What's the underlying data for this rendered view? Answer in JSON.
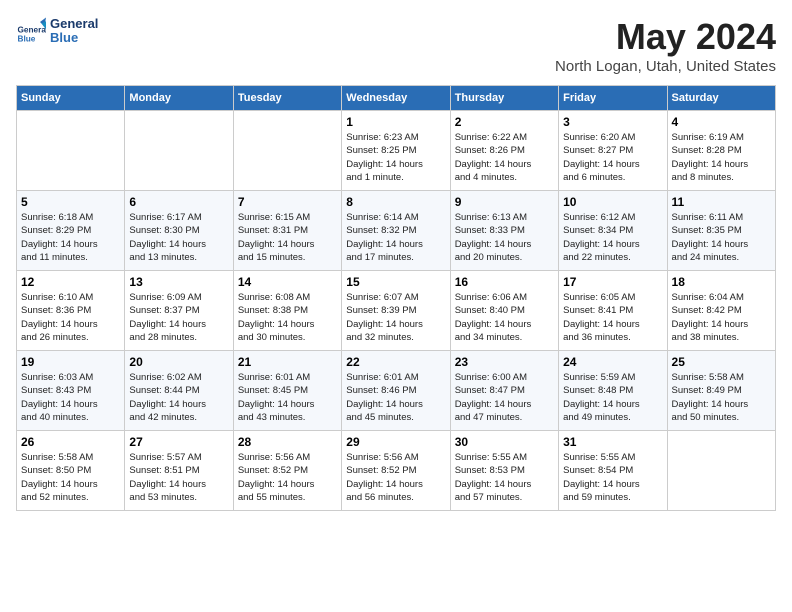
{
  "header": {
    "logo_line1": "General",
    "logo_line2": "Blue",
    "month": "May 2024",
    "location": "North Logan, Utah, United States"
  },
  "days_of_week": [
    "Sunday",
    "Monday",
    "Tuesday",
    "Wednesday",
    "Thursday",
    "Friday",
    "Saturday"
  ],
  "weeks": [
    [
      {
        "num": "",
        "info": ""
      },
      {
        "num": "",
        "info": ""
      },
      {
        "num": "",
        "info": ""
      },
      {
        "num": "1",
        "info": "Sunrise: 6:23 AM\nSunset: 8:25 PM\nDaylight: 14 hours\nand 1 minute."
      },
      {
        "num": "2",
        "info": "Sunrise: 6:22 AM\nSunset: 8:26 PM\nDaylight: 14 hours\nand 4 minutes."
      },
      {
        "num": "3",
        "info": "Sunrise: 6:20 AM\nSunset: 8:27 PM\nDaylight: 14 hours\nand 6 minutes."
      },
      {
        "num": "4",
        "info": "Sunrise: 6:19 AM\nSunset: 8:28 PM\nDaylight: 14 hours\nand 8 minutes."
      }
    ],
    [
      {
        "num": "5",
        "info": "Sunrise: 6:18 AM\nSunset: 8:29 PM\nDaylight: 14 hours\nand 11 minutes."
      },
      {
        "num": "6",
        "info": "Sunrise: 6:17 AM\nSunset: 8:30 PM\nDaylight: 14 hours\nand 13 minutes."
      },
      {
        "num": "7",
        "info": "Sunrise: 6:15 AM\nSunset: 8:31 PM\nDaylight: 14 hours\nand 15 minutes."
      },
      {
        "num": "8",
        "info": "Sunrise: 6:14 AM\nSunset: 8:32 PM\nDaylight: 14 hours\nand 17 minutes."
      },
      {
        "num": "9",
        "info": "Sunrise: 6:13 AM\nSunset: 8:33 PM\nDaylight: 14 hours\nand 20 minutes."
      },
      {
        "num": "10",
        "info": "Sunrise: 6:12 AM\nSunset: 8:34 PM\nDaylight: 14 hours\nand 22 minutes."
      },
      {
        "num": "11",
        "info": "Sunrise: 6:11 AM\nSunset: 8:35 PM\nDaylight: 14 hours\nand 24 minutes."
      }
    ],
    [
      {
        "num": "12",
        "info": "Sunrise: 6:10 AM\nSunset: 8:36 PM\nDaylight: 14 hours\nand 26 minutes."
      },
      {
        "num": "13",
        "info": "Sunrise: 6:09 AM\nSunset: 8:37 PM\nDaylight: 14 hours\nand 28 minutes."
      },
      {
        "num": "14",
        "info": "Sunrise: 6:08 AM\nSunset: 8:38 PM\nDaylight: 14 hours\nand 30 minutes."
      },
      {
        "num": "15",
        "info": "Sunrise: 6:07 AM\nSunset: 8:39 PM\nDaylight: 14 hours\nand 32 minutes."
      },
      {
        "num": "16",
        "info": "Sunrise: 6:06 AM\nSunset: 8:40 PM\nDaylight: 14 hours\nand 34 minutes."
      },
      {
        "num": "17",
        "info": "Sunrise: 6:05 AM\nSunset: 8:41 PM\nDaylight: 14 hours\nand 36 minutes."
      },
      {
        "num": "18",
        "info": "Sunrise: 6:04 AM\nSunset: 8:42 PM\nDaylight: 14 hours\nand 38 minutes."
      }
    ],
    [
      {
        "num": "19",
        "info": "Sunrise: 6:03 AM\nSunset: 8:43 PM\nDaylight: 14 hours\nand 40 minutes."
      },
      {
        "num": "20",
        "info": "Sunrise: 6:02 AM\nSunset: 8:44 PM\nDaylight: 14 hours\nand 42 minutes."
      },
      {
        "num": "21",
        "info": "Sunrise: 6:01 AM\nSunset: 8:45 PM\nDaylight: 14 hours\nand 43 minutes."
      },
      {
        "num": "22",
        "info": "Sunrise: 6:01 AM\nSunset: 8:46 PM\nDaylight: 14 hours\nand 45 minutes."
      },
      {
        "num": "23",
        "info": "Sunrise: 6:00 AM\nSunset: 8:47 PM\nDaylight: 14 hours\nand 47 minutes."
      },
      {
        "num": "24",
        "info": "Sunrise: 5:59 AM\nSunset: 8:48 PM\nDaylight: 14 hours\nand 49 minutes."
      },
      {
        "num": "25",
        "info": "Sunrise: 5:58 AM\nSunset: 8:49 PM\nDaylight: 14 hours\nand 50 minutes."
      }
    ],
    [
      {
        "num": "26",
        "info": "Sunrise: 5:58 AM\nSunset: 8:50 PM\nDaylight: 14 hours\nand 52 minutes."
      },
      {
        "num": "27",
        "info": "Sunrise: 5:57 AM\nSunset: 8:51 PM\nDaylight: 14 hours\nand 53 minutes."
      },
      {
        "num": "28",
        "info": "Sunrise: 5:56 AM\nSunset: 8:52 PM\nDaylight: 14 hours\nand 55 minutes."
      },
      {
        "num": "29",
        "info": "Sunrise: 5:56 AM\nSunset: 8:52 PM\nDaylight: 14 hours\nand 56 minutes."
      },
      {
        "num": "30",
        "info": "Sunrise: 5:55 AM\nSunset: 8:53 PM\nDaylight: 14 hours\nand 57 minutes."
      },
      {
        "num": "31",
        "info": "Sunrise: 5:55 AM\nSunset: 8:54 PM\nDaylight: 14 hours\nand 59 minutes."
      },
      {
        "num": "",
        "info": ""
      }
    ]
  ]
}
